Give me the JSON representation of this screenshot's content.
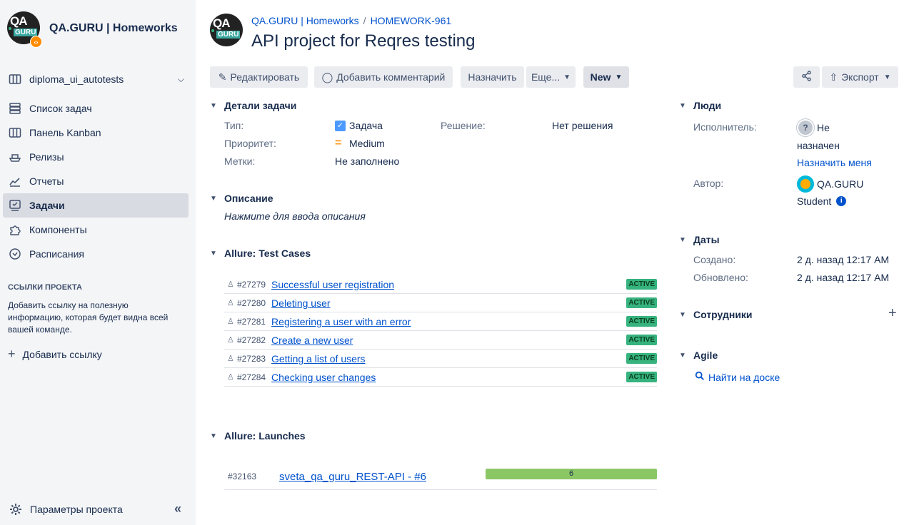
{
  "sidebar": {
    "project_title": "QA.GURU | Homeworks",
    "logo_text_top": "QA",
    "logo_text_bottom": "GURU",
    "board": "diploma_ui_autotests",
    "nav": [
      {
        "label": "Список задач",
        "icon": "backlog-icon"
      },
      {
        "label": "Панель Kanban",
        "icon": "board-icon"
      },
      {
        "label": "Релизы",
        "icon": "ship-icon"
      },
      {
        "label": "Отчеты",
        "icon": "chart-icon"
      },
      {
        "label": "Задачи",
        "icon": "issues-icon"
      },
      {
        "label": "Компоненты",
        "icon": "puzzle-icon"
      },
      {
        "label": "Расписания",
        "icon": "clock-icon"
      }
    ],
    "links_title": "ССЫЛКИ ПРОЕКТА",
    "links_desc": "Добавить ссылку на полезную информацию, которая будет видна всей вашей команде.",
    "add_link": "Добавить ссылку",
    "settings": "Параметры проекта"
  },
  "header": {
    "crumb_project": "QA.GURU | Homeworks",
    "crumb_issue": "HOMEWORK-961",
    "title": "API project for Reqres testing"
  },
  "toolbar": {
    "edit": "Редактировать",
    "comment": "Добавить комментарий",
    "assign": "Назначить",
    "more": "Еще...",
    "status": "New",
    "export": "Экспорт"
  },
  "details": {
    "heading": "Детали задачи",
    "type_label": "Тип:",
    "type_value": "Задача",
    "priority_label": "Приоритет:",
    "priority_value": "Medium",
    "labels_label": "Метки:",
    "labels_value": "Не заполнено",
    "resolution_label": "Решение:",
    "resolution_value": "Нет решения"
  },
  "description": {
    "heading": "Описание",
    "placeholder": "Нажмите для ввода описания"
  },
  "test_cases": {
    "heading": "Allure: Test Cases",
    "rows": [
      {
        "id": "#27279",
        "name": "Successful user registration",
        "status": "ACTIVE"
      },
      {
        "id": "#27280",
        "name": "Deleting user",
        "status": "ACTIVE"
      },
      {
        "id": "#27281",
        "name": "Registering a user with an error",
        "status": "ACTIVE"
      },
      {
        "id": "#27282",
        "name": "Create a new user",
        "status": "ACTIVE"
      },
      {
        "id": "#27283",
        "name": "Getting a list of users",
        "status": "ACTIVE"
      },
      {
        "id": "#27284",
        "name": "Checking user changes",
        "status": "ACTIVE"
      }
    ]
  },
  "launches": {
    "heading": "Allure: Launches",
    "rows": [
      {
        "id": "#32163",
        "name": "sveta_qa_guru_REST-API - #6",
        "count": "6"
      }
    ]
  },
  "people": {
    "heading": "Люди",
    "assignee_label": "Исполнитель:",
    "assignee_value_1": "Не",
    "assignee_value_2": "назначен",
    "assign_me": "Назначить меня",
    "author_label": "Автор:",
    "author_value_1": "QA.GURU",
    "author_value_2": "Student"
  },
  "dates": {
    "heading": "Даты",
    "created_label": "Создано:",
    "created_value": "2 д. назад 12:17 AM",
    "updated_label": "Обновлено:",
    "updated_value": "2 д. назад 12:17 AM"
  },
  "employees": {
    "heading": "Сотрудники"
  },
  "agile": {
    "heading": "Agile",
    "find_on_board": "Найти на доске"
  },
  "colors": {
    "accent": "#0052cc",
    "status_green": "#36b37e",
    "launch_bar": "#8cc765",
    "sidebar_bg": "#f4f5f7"
  }
}
